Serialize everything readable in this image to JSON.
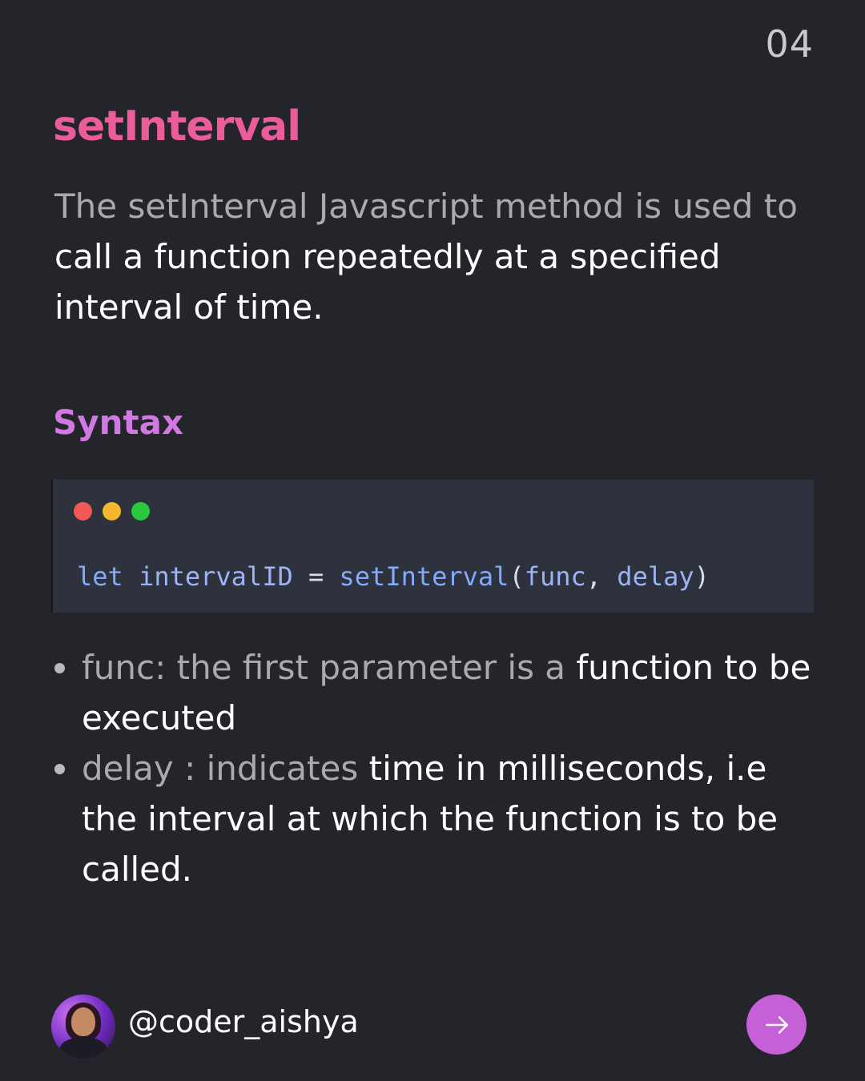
{
  "page_number": "04",
  "title": "setInterval",
  "intro": {
    "muted": "The setInterval Javascript method is used to ",
    "bright": "call a function repeatedly at a specified interval of time."
  },
  "syntax_heading": "Syntax",
  "code": {
    "keyword": "let",
    "variable": "intervalID",
    "operator": "=",
    "function": "setInterval",
    "open_paren": "(",
    "param1": "func",
    "comma": ",",
    "param2": "delay",
    "close_paren": ")"
  },
  "bullets": [
    {
      "muted": "func: the first parameter is a ",
      "bright": "function to be executed"
    },
    {
      "muted": "delay : indicates ",
      "bright": "time in milliseconds, i.e the interval at which the function is to be called."
    }
  ],
  "footer": {
    "handle": "@coder_aishya",
    "next_icon": "arrow-right-icon"
  },
  "colors": {
    "background": "#24252b",
    "title": "#ea5c9a",
    "syntax_heading": "#d178e3",
    "code_bg": "#2d323c",
    "next_button": "#c660d6"
  }
}
